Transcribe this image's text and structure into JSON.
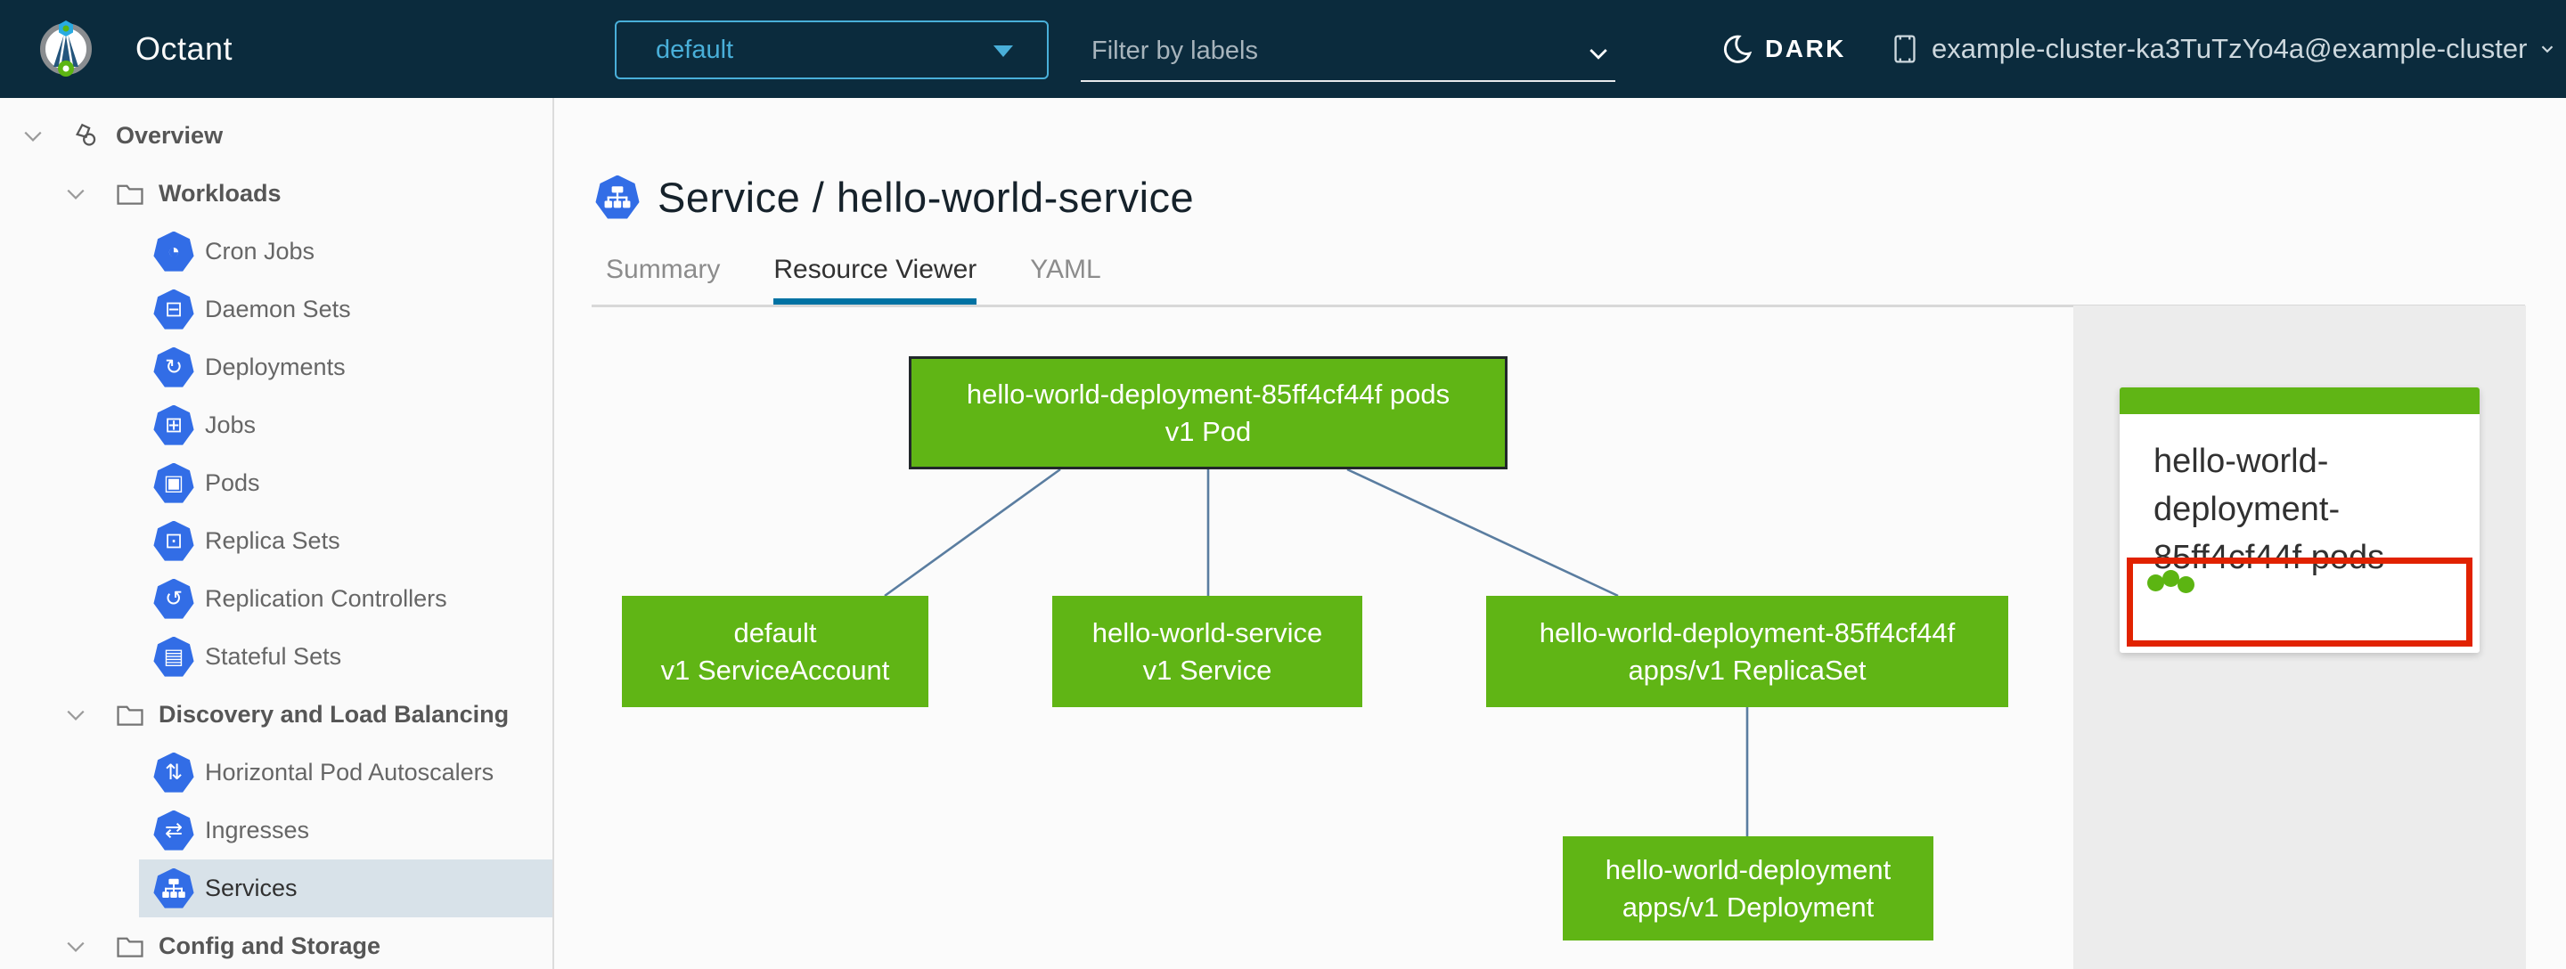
{
  "header": {
    "app_title": "Octant",
    "namespace_dropdown": {
      "value": "default"
    },
    "filter_input": {
      "placeholder": "Filter by labels"
    },
    "theme_toggle": {
      "label": "DARK"
    },
    "cluster_context": {
      "label": "example-cluster-ka3TuTzYo4a@example-cluster"
    }
  },
  "sidebar": {
    "items": [
      {
        "label": "Overview",
        "depth": 0,
        "icon": "overview-icon",
        "expanded": true,
        "selected": false
      },
      {
        "label": "Workloads",
        "depth": 1,
        "icon": "folder-icon",
        "expanded": true,
        "selected": false
      },
      {
        "label": "Cron Jobs",
        "depth": 2,
        "icon": "cron-jobs-icon",
        "selected": false
      },
      {
        "label": "Daemon Sets",
        "depth": 2,
        "icon": "daemon-sets-icon",
        "selected": false
      },
      {
        "label": "Deployments",
        "depth": 2,
        "icon": "deployments-icon",
        "selected": false
      },
      {
        "label": "Jobs",
        "depth": 2,
        "icon": "jobs-icon",
        "selected": false
      },
      {
        "label": "Pods",
        "depth": 2,
        "icon": "pods-icon",
        "selected": false
      },
      {
        "label": "Replica Sets",
        "depth": 2,
        "icon": "replica-sets-icon",
        "selected": false
      },
      {
        "label": "Replication Controllers",
        "depth": 2,
        "icon": "replication-controllers-icon",
        "selected": false
      },
      {
        "label": "Stateful Sets",
        "depth": 2,
        "icon": "stateful-sets-icon",
        "selected": false
      },
      {
        "label": "Discovery and Load Balancing",
        "depth": 1,
        "icon": "folder-icon",
        "expanded": true,
        "selected": false
      },
      {
        "label": "Horizontal Pod Autoscalers",
        "depth": 2,
        "icon": "horizontal-pod-autoscalers-icon",
        "selected": false
      },
      {
        "label": "Ingresses",
        "depth": 2,
        "icon": "ingresses-icon",
        "selected": false
      },
      {
        "label": "Services",
        "depth": 2,
        "icon": "services-icon",
        "selected": true
      },
      {
        "label": "Config and Storage",
        "depth": 1,
        "icon": "folder-icon",
        "expanded": true,
        "selected": false
      }
    ]
  },
  "main": {
    "title": {
      "text": "Service / hello-world-service",
      "icon": "service-icon"
    },
    "tabs": [
      {
        "label": "Summary",
        "active": false
      },
      {
        "label": "Resource Viewer",
        "active": true
      },
      {
        "label": "YAML",
        "active": false
      }
    ],
    "graph": {
      "nodes": [
        {
          "id": "pod",
          "name": "hello-world-deployment-85ff4cf44f pods",
          "kind": "v1 Pod",
          "selected": true
        },
        {
          "id": "service-account",
          "name": "default",
          "kind": "v1 ServiceAccount",
          "selected": false
        },
        {
          "id": "service",
          "name": "hello-world-service",
          "kind": "v1 Service",
          "selected": false
        },
        {
          "id": "replica-set",
          "name": "hello-world-deployment-85ff4cf44f",
          "kind": "apps/v1 ReplicaSet",
          "selected": false
        },
        {
          "id": "deployment",
          "name": "hello-world-deployment",
          "kind": "apps/v1 Deployment",
          "selected": false
        }
      ]
    },
    "detail_panel": {
      "card": {
        "title": "hello-world-deployment-85ff4cf44f pods",
        "status_dot_count": 3
      }
    }
  },
  "colors": {
    "header_bg": "#0b2b3d",
    "accent_blue": "#49afd9",
    "k8s_icon_blue": "#326de6",
    "node_green": "#60b515",
    "edge_blue": "#5a7da0",
    "alert_red": "#e12200",
    "tab_underline": "#0072a3",
    "selected_row_bg": "#d8e2e9"
  }
}
